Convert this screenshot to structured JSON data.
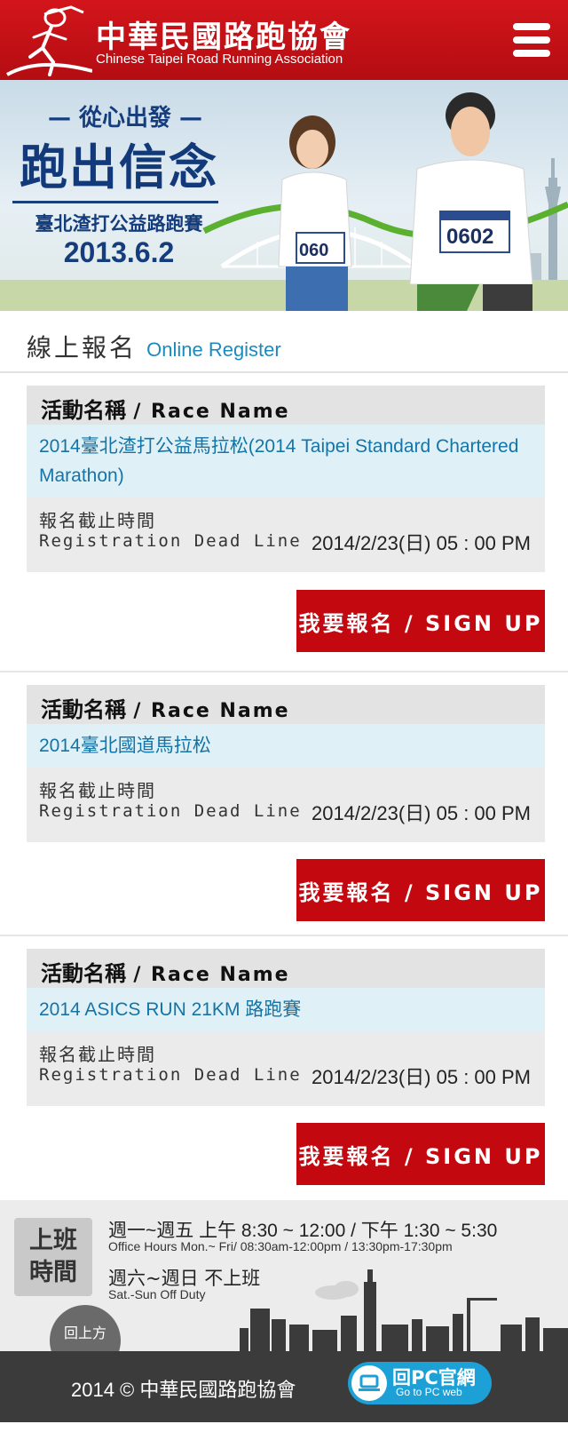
{
  "header": {
    "title_cn": "中華民國路跑協會",
    "title_en": "Chinese Taipei Road Running Association",
    "brand_color": "#c3080f",
    "menu_icon": "hamburger-menu-icon"
  },
  "banner": {
    "slogan": "— 從心出發 —",
    "headline": "跑出信念",
    "event": "臺北渣打公益路跑賽",
    "date": "2013.6.2",
    "bib_number": "0602",
    "bib_number_partial": "060"
  },
  "section": {
    "title_cn": "線上報名",
    "title_en": "Online Register"
  },
  "labels": {
    "race_name_cn": "活動名稱",
    "race_name_en": "/ Race Name",
    "deadline_cn": "報名截止時間",
    "deadline_en": "Registration  Dead Line",
    "signup": "我要報名 / SIGN UP"
  },
  "races": [
    {
      "name": "2014臺北渣打公益馬拉松(2014 Taipei Standard Chartered Marathon)",
      "deadline": "2014/2/23(日) 05 : 00 PM"
    },
    {
      "name": "2014臺北國道馬拉松",
      "deadline": "2014/2/23(日) 05 : 00 PM"
    },
    {
      "name": "2014 ASICS RUN 21KM 路跑賽",
      "deadline": "2014/2/23(日) 05 : 00 PM"
    }
  ],
  "office": {
    "badge_line1": "上班",
    "badge_line2": "時間",
    "weekday_cn": "週一~週五 上午 8:30 ~ 12:00 / 下午 1:30 ~ 5:30",
    "weekday_en": "Office Hours  Mon.~ Fri/ 08:30am-12:00pm / 13:30pm-17:30pm",
    "weekend_cn": "週六~週日 不上班",
    "weekend_en": "Sat.-Sun Off Duty"
  },
  "footer": {
    "back_to_top": "回上方",
    "copyright": "2014 © 中華民國路跑協會",
    "pc_label": "回PC官網",
    "pc_sub": "Go to PC web"
  }
}
